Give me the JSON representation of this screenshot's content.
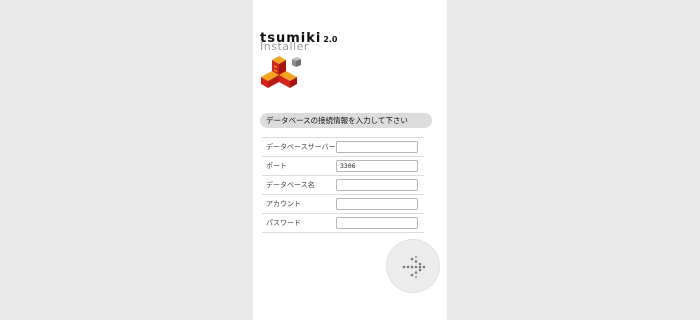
{
  "brand": {
    "name": "tsumiki",
    "version": "2.0",
    "subtitle": "Installer"
  },
  "section": {
    "title": "データベースの接続情報を入力して下さい"
  },
  "form": {
    "fields": [
      {
        "label": "データベースサーバー",
        "value": ""
      },
      {
        "label": "ポート",
        "value": "3306"
      },
      {
        "label": "データベース名",
        "value": ""
      },
      {
        "label": "アカウント",
        "value": ""
      },
      {
        "label": "パスワード",
        "value": ""
      }
    ]
  },
  "next_button": {
    "icon": "dotted-arrow-right-icon"
  },
  "colors": {
    "logo_red": "#d6241b",
    "logo_orange": "#f2a51f",
    "logo_gray": "#8c8c8c"
  }
}
